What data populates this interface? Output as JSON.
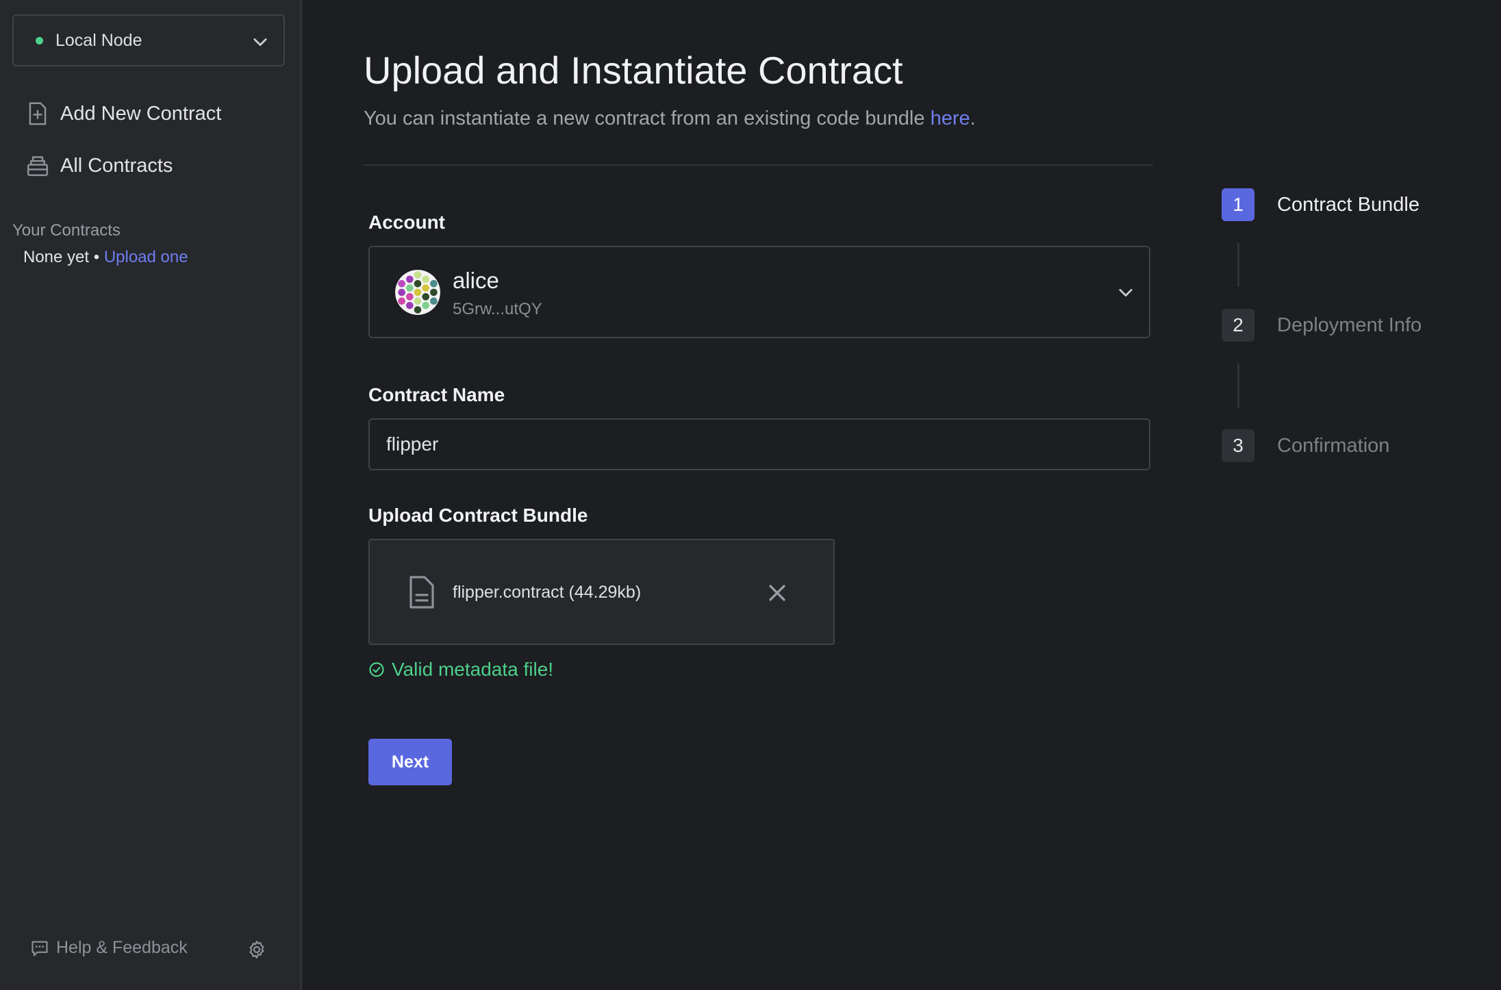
{
  "sidebar": {
    "node": {
      "label": "Local Node",
      "status_color": "#4cd08a"
    },
    "nav": [
      {
        "label": "Add New Contract",
        "icon": "file-plus-icon"
      },
      {
        "label": "All Contracts",
        "icon": "archive-icon"
      }
    ],
    "your_contracts": {
      "heading": "Your Contracts",
      "empty_text": "None yet •",
      "upload_link": "Upload one"
    },
    "footer": {
      "help_label": "Help & Feedback",
      "settings_icon": "gear-icon"
    }
  },
  "main": {
    "title": "Upload and Instantiate Contract",
    "subtitle_text": "You can instantiate a new contract from an existing code bundle ",
    "subtitle_link": "here",
    "subtitle_end": ".",
    "account": {
      "label": "Account",
      "name": "alice",
      "address": "5Grw...utQY"
    },
    "contract_name": {
      "label": "Contract Name",
      "value": "flipper"
    },
    "upload": {
      "label": "Upload Contract Bundle",
      "file_name": "flipper.contract (44.29kb)",
      "valid_text": "Valid metadata file!"
    },
    "next_label": "Next"
  },
  "steps": [
    {
      "number": "1",
      "label": "Contract Bundle",
      "active": true
    },
    {
      "number": "2",
      "label": "Deployment Info",
      "active": false
    },
    {
      "number": "3",
      "label": "Confirmation",
      "active": false
    }
  ],
  "colors": {
    "accent": "#5a68df",
    "link": "#6f7ef0",
    "success": "#4cd08a",
    "background": "#1d1e21",
    "sidebar": "#26282c"
  }
}
